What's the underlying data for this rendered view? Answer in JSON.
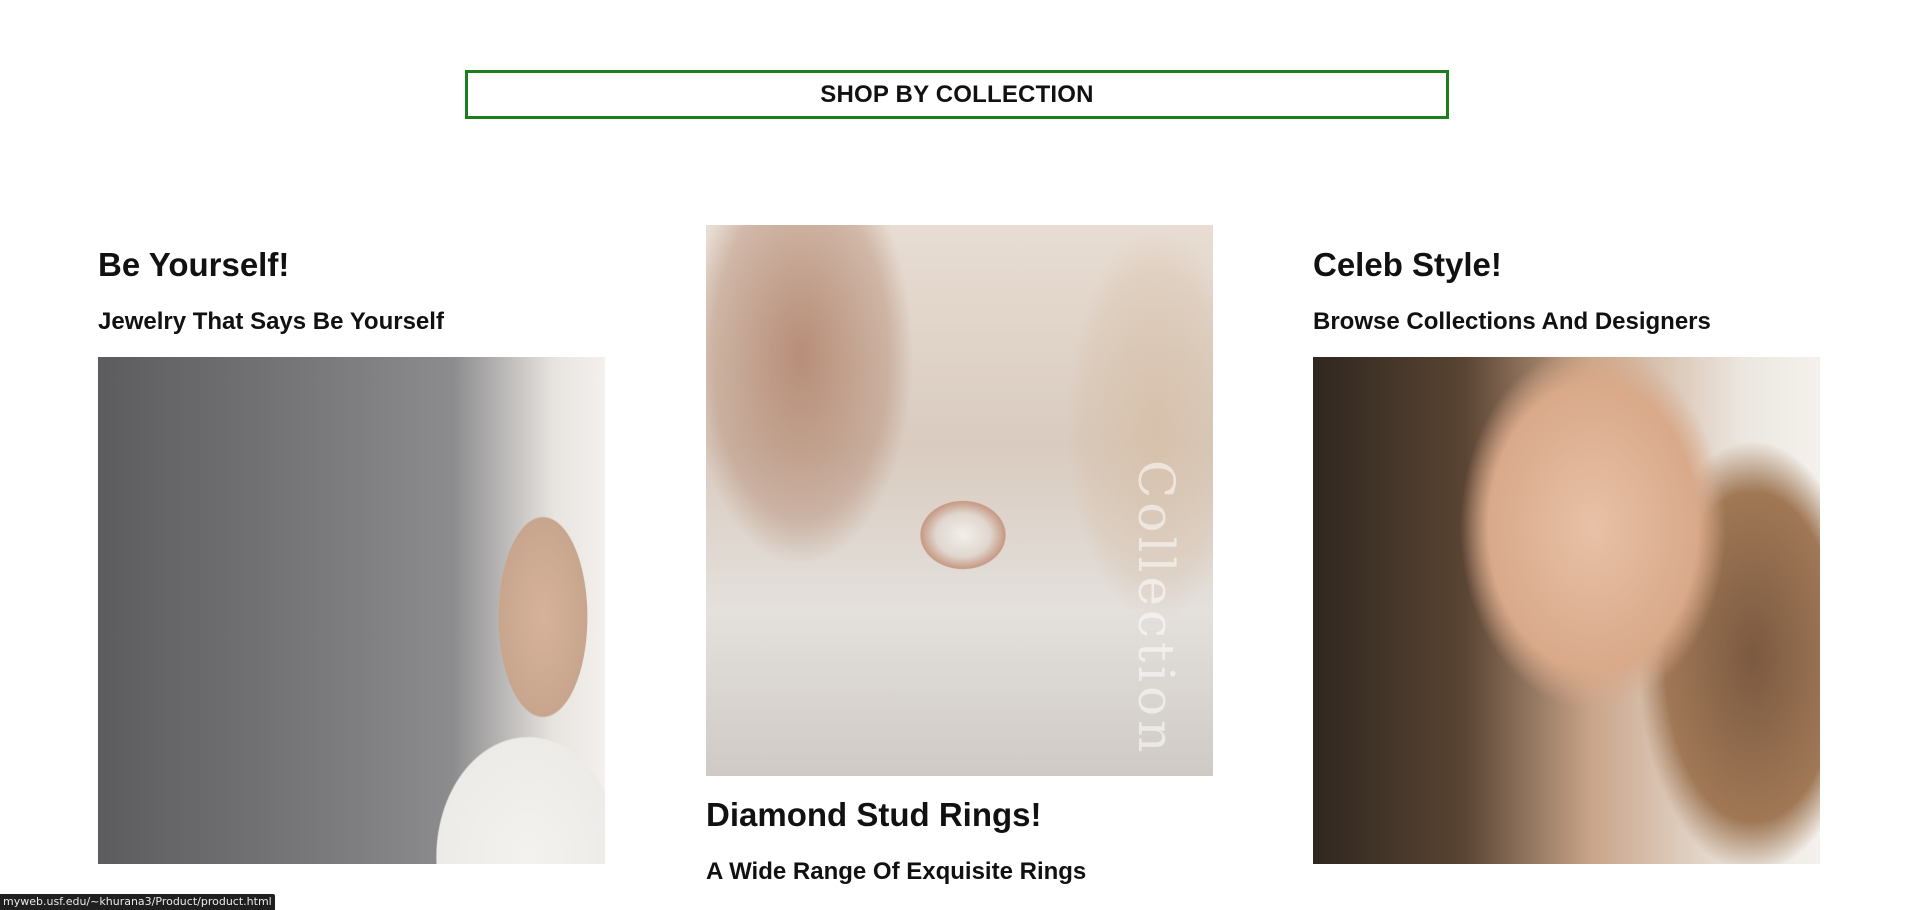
{
  "banner": {
    "label": "SHOP BY COLLECTION"
  },
  "collections": [
    {
      "title": "Be Yourself!",
      "subtitle": "Jewelry That Says Be Yourself",
      "image_alt": "portrait-earrings-image"
    },
    {
      "title": "Diamond Stud Rings!",
      "subtitle": "A Wide Range Of Exquisite Rings",
      "image_alt": "diamond-ring-image",
      "watermark": "Collection"
    },
    {
      "title": "Celeb Style!",
      "subtitle": "Browse Collections And Designers",
      "image_alt": "woman-earrings-image"
    }
  ],
  "status_bar": {
    "url": "myweb.usf.edu/~khurana3/Product/product.html"
  },
  "colors": {
    "banner_border": "#1b7d1b",
    "text": "#111111",
    "background": "#ffffff"
  }
}
